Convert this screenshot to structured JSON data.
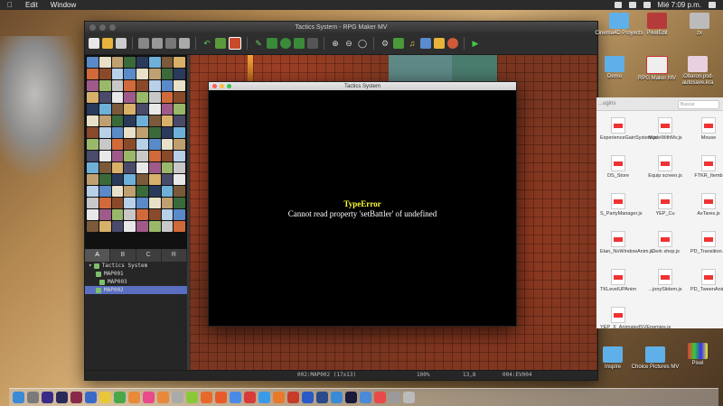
{
  "menubar": {
    "items": [
      "Edit",
      "Window"
    ],
    "clock": "Mié 7:09 p.m."
  },
  "editor": {
    "title": "Tactics System - RPG Maker MV",
    "tile_tabs": [
      "A",
      "B",
      "C",
      "R"
    ],
    "tree": {
      "root": "Tactics System",
      "maps": [
        "MAP001",
        "MAP003",
        "MAP002"
      ],
      "selected": "MAP002"
    },
    "status": {
      "map": "002:MAP002 (17x13)",
      "zoom": "100%",
      "coords": "13,8",
      "event": "004:EV004"
    }
  },
  "game_window": {
    "title": "Tactics System",
    "error_title": "TypeError",
    "error_message": "Cannot read property 'setBattler' of undefined"
  },
  "finder": {
    "search_placeholder": "Buscar",
    "header": "...ugins",
    "files": [
      "ExperienceGainSystem.js",
      "ModeWithMv.js",
      "Mouse",
      "DS_Store",
      "Equip screen.js",
      "FTKR_Itemb",
      "S_PartyManager.js",
      "YEP_Cu",
      "AxTares.js",
      "Etan_NoWindowAnim.js",
      "Clerk shop.js",
      "PD_Transition.js",
      "TKLevelUPAnim",
      "...jonySlidem.js",
      "PD_TweenAnimation.js",
      "YEP_X_AnimatedSVEnemies.js"
    ]
  },
  "desktop": {
    "icons": [
      "Cinema4D Proyects",
      "PixelEdit",
      "zx",
      "Demo",
      "RPG Maker MV",
      ".Obaron.psd-autosave.kra",
      "Inspire",
      "Choice Pictures MV",
      "Pixel"
    ]
  },
  "dock": {
    "apps": [
      "Finder",
      "Prefs",
      "Premiere",
      "After Effects",
      "InDesign",
      "Sv",
      "Chrome",
      "Maps",
      "Photos",
      "iTunes",
      "VLC",
      "Tools",
      "Android",
      "Blender",
      "Firefox",
      "Chrome",
      "Opera",
      "Safari",
      "Illustrator",
      "Animate",
      "Photoshop",
      "Lightroom",
      "Finder",
      "Steam",
      "Mail",
      "Calendar",
      "Launchpad",
      "Trash"
    ]
  }
}
